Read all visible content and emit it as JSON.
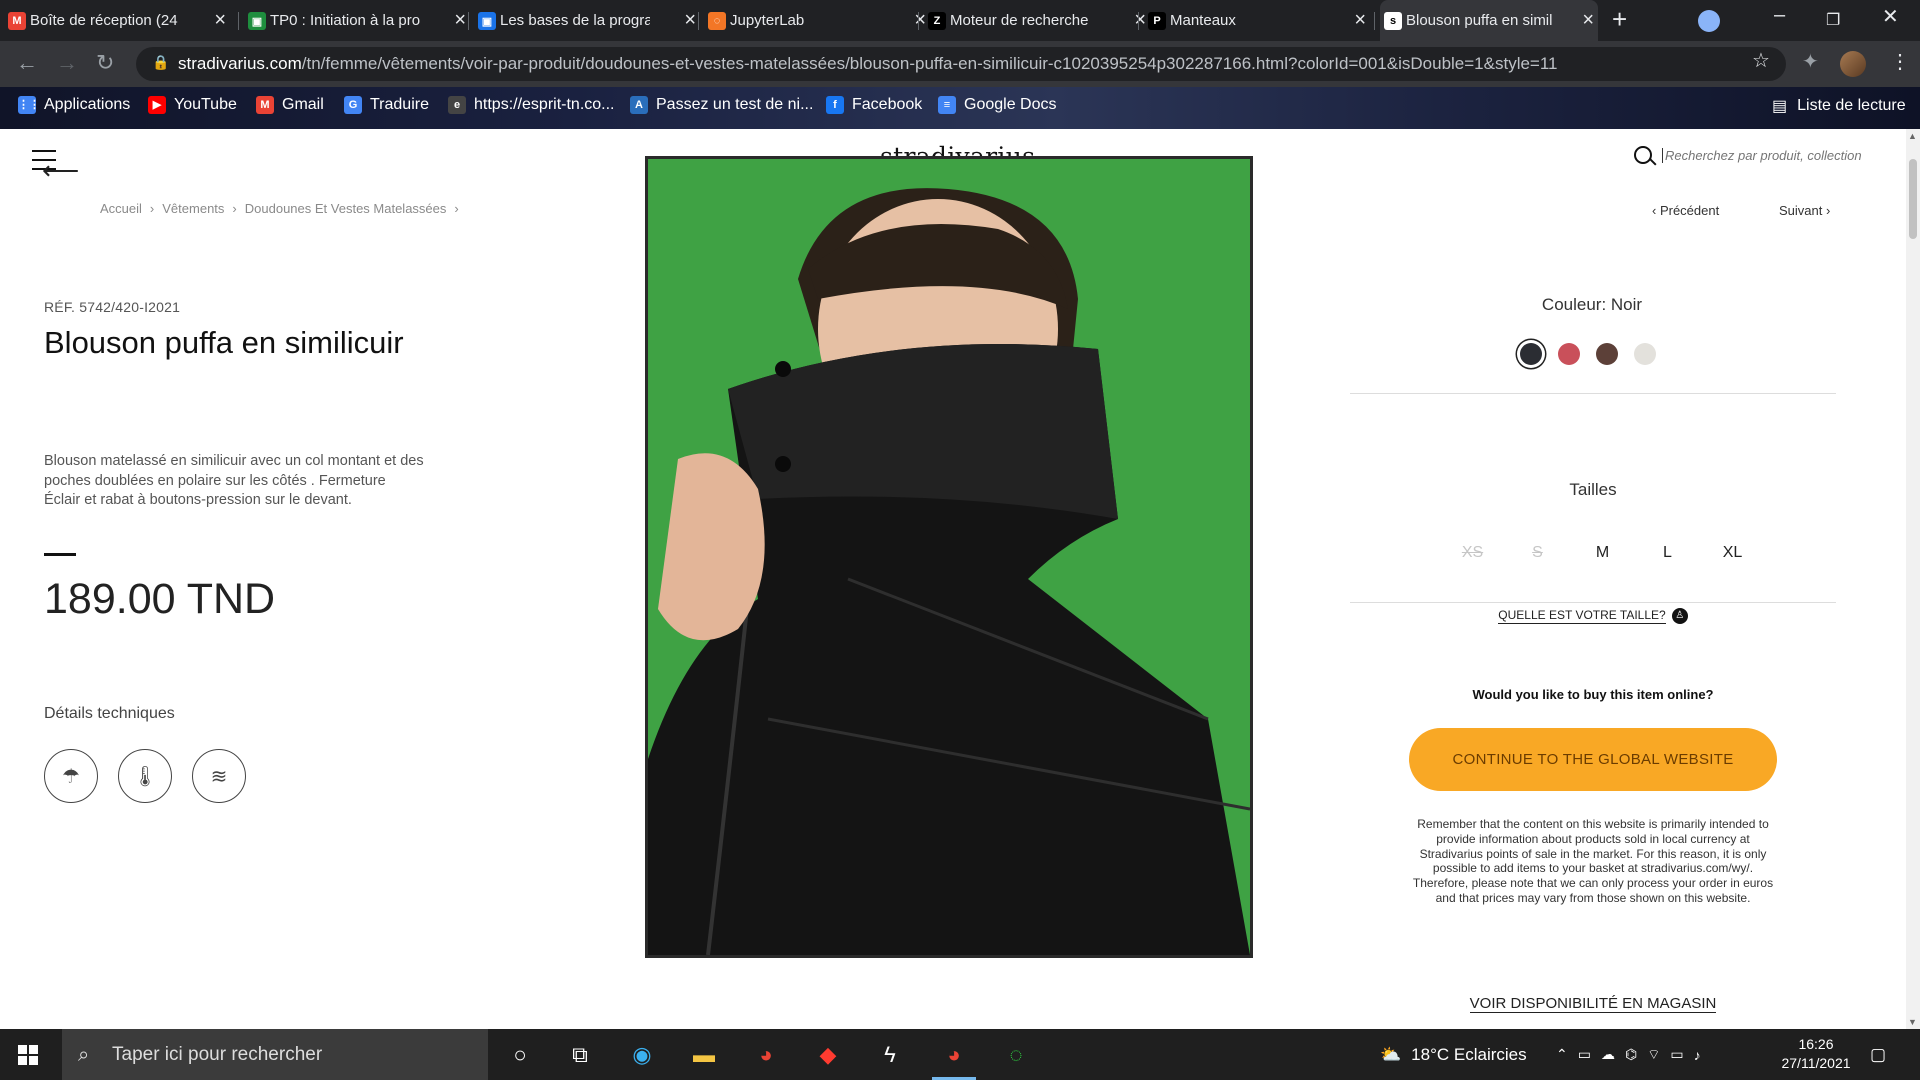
{
  "browser": {
    "tabs": [
      {
        "title": "Boîte de réception (24",
        "icon": "gmail-icon",
        "color": "#ea4335",
        "glyph": "M"
      },
      {
        "title": "TP0 : Initiation à la pro",
        "icon": "classroom-icon",
        "color": "#1e8e3e",
        "glyph": "▣"
      },
      {
        "title": "Les bases de la progra",
        "icon": "classroom-icon",
        "color": "#1a73e8",
        "glyph": "▣"
      },
      {
        "title": "JupyterLab",
        "icon": "jupyter-icon",
        "color": "#f37626",
        "glyph": "◌"
      },
      {
        "title": "Moteur de recherche",
        "icon": "zara-icon",
        "color": "#000000",
        "glyph": "Z"
      },
      {
        "title": "Manteaux",
        "icon": "pullbear-icon",
        "color": "#000000",
        "glyph": "P"
      },
      {
        "title": "Blouson puffa en simil",
        "icon": "stradivarius-icon",
        "color": "#ffffff",
        "glyph": "s"
      }
    ],
    "url_domain": "stradivarius.com",
    "url_path": "/tn/femme/vêtements/voir-par-produit/doudounes-et-vestes-matelassées/blouson-puffa-en-similicuir-c1020395254p302287166.html?colorId=001&isDouble=1&style=11",
    "bookmarks": [
      {
        "label": "Applications",
        "icon": "apps-grid-icon",
        "color": "#4285f4",
        "glyph": "⋮⋮"
      },
      {
        "label": "YouTube",
        "icon": "youtube-icon",
        "color": "#ff0000",
        "glyph": "▶"
      },
      {
        "label": "Gmail",
        "icon": "gmail-icon",
        "color": "#ea4335",
        "glyph": "M"
      },
      {
        "label": "Traduire",
        "icon": "translate-icon",
        "color": "#4285f4",
        "glyph": "G"
      },
      {
        "label": "https://esprit-tn.co...",
        "icon": "esprit-icon",
        "color": "#444444",
        "glyph": "e"
      },
      {
        "label": "Passez un test de ni...",
        "icon": "test-icon",
        "color": "#2a6ebb",
        "glyph": "A"
      },
      {
        "label": "Facebook",
        "icon": "facebook-icon",
        "color": "#1877f2",
        "glyph": "f"
      },
      {
        "label": "Google Docs",
        "icon": "docs-icon",
        "color": "#4285f4",
        "glyph": "≡"
      }
    ],
    "reading_list": "Liste de lecture"
  },
  "site": {
    "logo": "stradivarius",
    "search_placeholder": "Recherchez par produit, collection..."
  },
  "breadcrumb": [
    "Accueil",
    "Vêtements",
    "Doudounes Et Vestes Matelassées"
  ],
  "nav": {
    "prev": "Précédent",
    "next": "Suivant"
  },
  "product": {
    "ref": "RÉF. 5742/420-I2021",
    "title": "Blouson puffa en similicuir",
    "description": "Blouson matelassé en similicuir avec un col montant et des poches doublées en polaire sur les côtés . Fermeture Éclair et rabat à boutons-pression sur le devant.",
    "price": "189.00 TND",
    "tech_title": "Détails techniques",
    "tech_icons": [
      "umbrella-rain-icon",
      "thermometer-cold-icon",
      "wind-icon"
    ]
  },
  "color": {
    "label": "Couleur: Noir",
    "swatches": [
      {
        "name": "Noir",
        "hex": "#2b2d33",
        "selected": true
      },
      {
        "name": "Rouge",
        "hex": "#c9505a",
        "selected": false
      },
      {
        "name": "Marron",
        "hex": "#5c4038",
        "selected": false
      },
      {
        "name": "Écru",
        "hex": "#e3e1dc",
        "selected": false
      }
    ]
  },
  "sizes": {
    "title": "Tailles",
    "items": [
      {
        "label": "XS",
        "available": false
      },
      {
        "label": "S",
        "available": false
      },
      {
        "label": "M",
        "available": true
      },
      {
        "label": "L",
        "available": true
      },
      {
        "label": "XL",
        "available": true
      }
    ],
    "guide": "QUELLE EST VOTRE TAILLE?"
  },
  "purchase": {
    "question": "Would you like to buy this item online?",
    "cta": "CONTINUE TO THE GLOBAL WEBSITE",
    "notice": "Remember that the content on this website is primarily intended to provide information about products sold in local currency at Stradivarius points of sale in the market. For this reason, it is only possible to add items to your basket at stradivarius.com/wy/. Therefore, please note that we can only process your order in euros and that prices may vary from those shown on this website.",
    "store": "VOIR DISPONIBILITÉ EN MAGASIN"
  },
  "colors": {
    "accent": "#f9a825",
    "background": "#ffffff",
    "photo_bg": "#3fa244"
  },
  "taskbar": {
    "search_placeholder": "Taper ici pour rechercher",
    "weather": "18°C Eclaircies",
    "time": "16:26",
    "date": "27/11/2021"
  }
}
